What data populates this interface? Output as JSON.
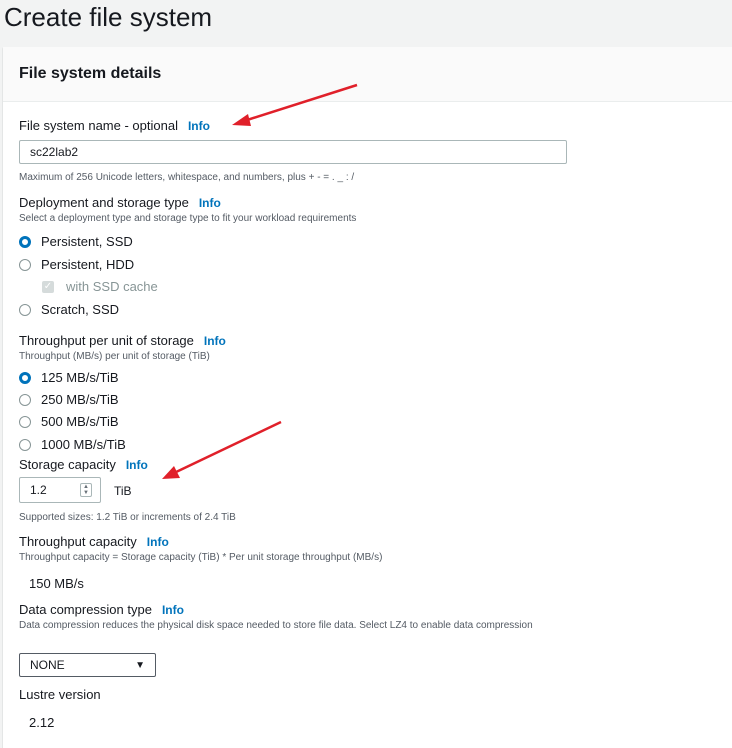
{
  "page": {
    "title": "Create file system"
  },
  "panel": {
    "title": "File system details"
  },
  "info_label": "Info",
  "name_field": {
    "label": "File system name - optional",
    "value": "sc22lab2",
    "hint": "Maximum of 256 Unicode letters, whitespace, and numbers, plus + - = . _ : /"
  },
  "deployment": {
    "label": "Deployment and storage type",
    "description": "Select a deployment type and storage type to fit your workload requirements",
    "options": [
      "Persistent, SSD",
      "Persistent, HDD",
      "Scratch, SSD"
    ],
    "selected": "Persistent, SSD",
    "ssd_cache": {
      "label": "with SSD cache",
      "checked": true,
      "disabled": true
    }
  },
  "throughput": {
    "label": "Throughput per unit of storage",
    "description": "Throughput (MB/s) per unit of storage (TiB)",
    "options": [
      "125 MB/s/TiB",
      "250 MB/s/TiB",
      "500 MB/s/TiB",
      "1000 MB/s/TiB"
    ],
    "selected": "125 MB/s/TiB"
  },
  "storage_capacity": {
    "label": "Storage capacity",
    "value": "1.2",
    "unit": "TiB",
    "hint": "Supported sizes: 1.2 TiB or increments of 2.4 TiB"
  },
  "throughput_capacity": {
    "label": "Throughput capacity",
    "description": "Throughput capacity = Storage capacity (TiB) * Per unit storage throughput (MB/s)",
    "value": "150 MB/s"
  },
  "compression": {
    "label": "Data compression type",
    "description": "Data compression reduces the physical disk space needed to store file data. Select LZ4 to enable data compression",
    "selected": "NONE"
  },
  "lustre": {
    "label": "Lustre version",
    "value": "2.12"
  },
  "colors": {
    "accent": "#0073bb",
    "annotation_arrow": "#e0202a"
  }
}
